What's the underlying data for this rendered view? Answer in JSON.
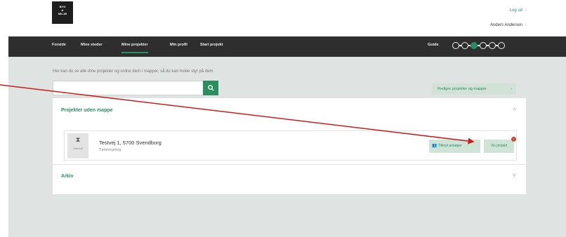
{
  "header": {
    "logo_lines": [
      "BYG",
      "&",
      "MILJØ"
    ],
    "logout": "Log ud",
    "user_name": "Anders Andersen",
    "chevron": "›"
  },
  "nav": {
    "items": [
      {
        "label": "Forside"
      },
      {
        "label": "Mine steder"
      },
      {
        "label": "Mine projekter"
      },
      {
        "label": "Min profil"
      },
      {
        "label": "Start projekt"
      }
    ],
    "active_index": 2,
    "guide_label": "Guide",
    "guide_steps_total": 6,
    "guide_step_current": 3
  },
  "main": {
    "intro": "Her kan du se alle dine projekter og ordne dem i mapper, så du kan holde styr på dem",
    "search_placeholder": "",
    "search_icon": "search-icon",
    "edit_button": "Rediger projekter og mapper",
    "edit_chevron": "›",
    "panels": [
      {
        "title": "Projekter uden mappe",
        "chevron": "^",
        "projects": [
          {
            "thumb_label": "Indsendt",
            "address": "Testvej 1, 5700 Svendborg",
            "type": "Tømrergning",
            "apply_button": "Tilknyt ansøger",
            "view_button": "Vis projekt",
            "badge": "!"
          }
        ]
      },
      {
        "title": "Arkiv",
        "chevron": "˅"
      }
    ]
  },
  "colors": {
    "accent": "#2a8f5f",
    "nav_bg": "#2e2e2e",
    "content_bg": "#dfe3e1",
    "arrow": "#c81e1e"
  }
}
